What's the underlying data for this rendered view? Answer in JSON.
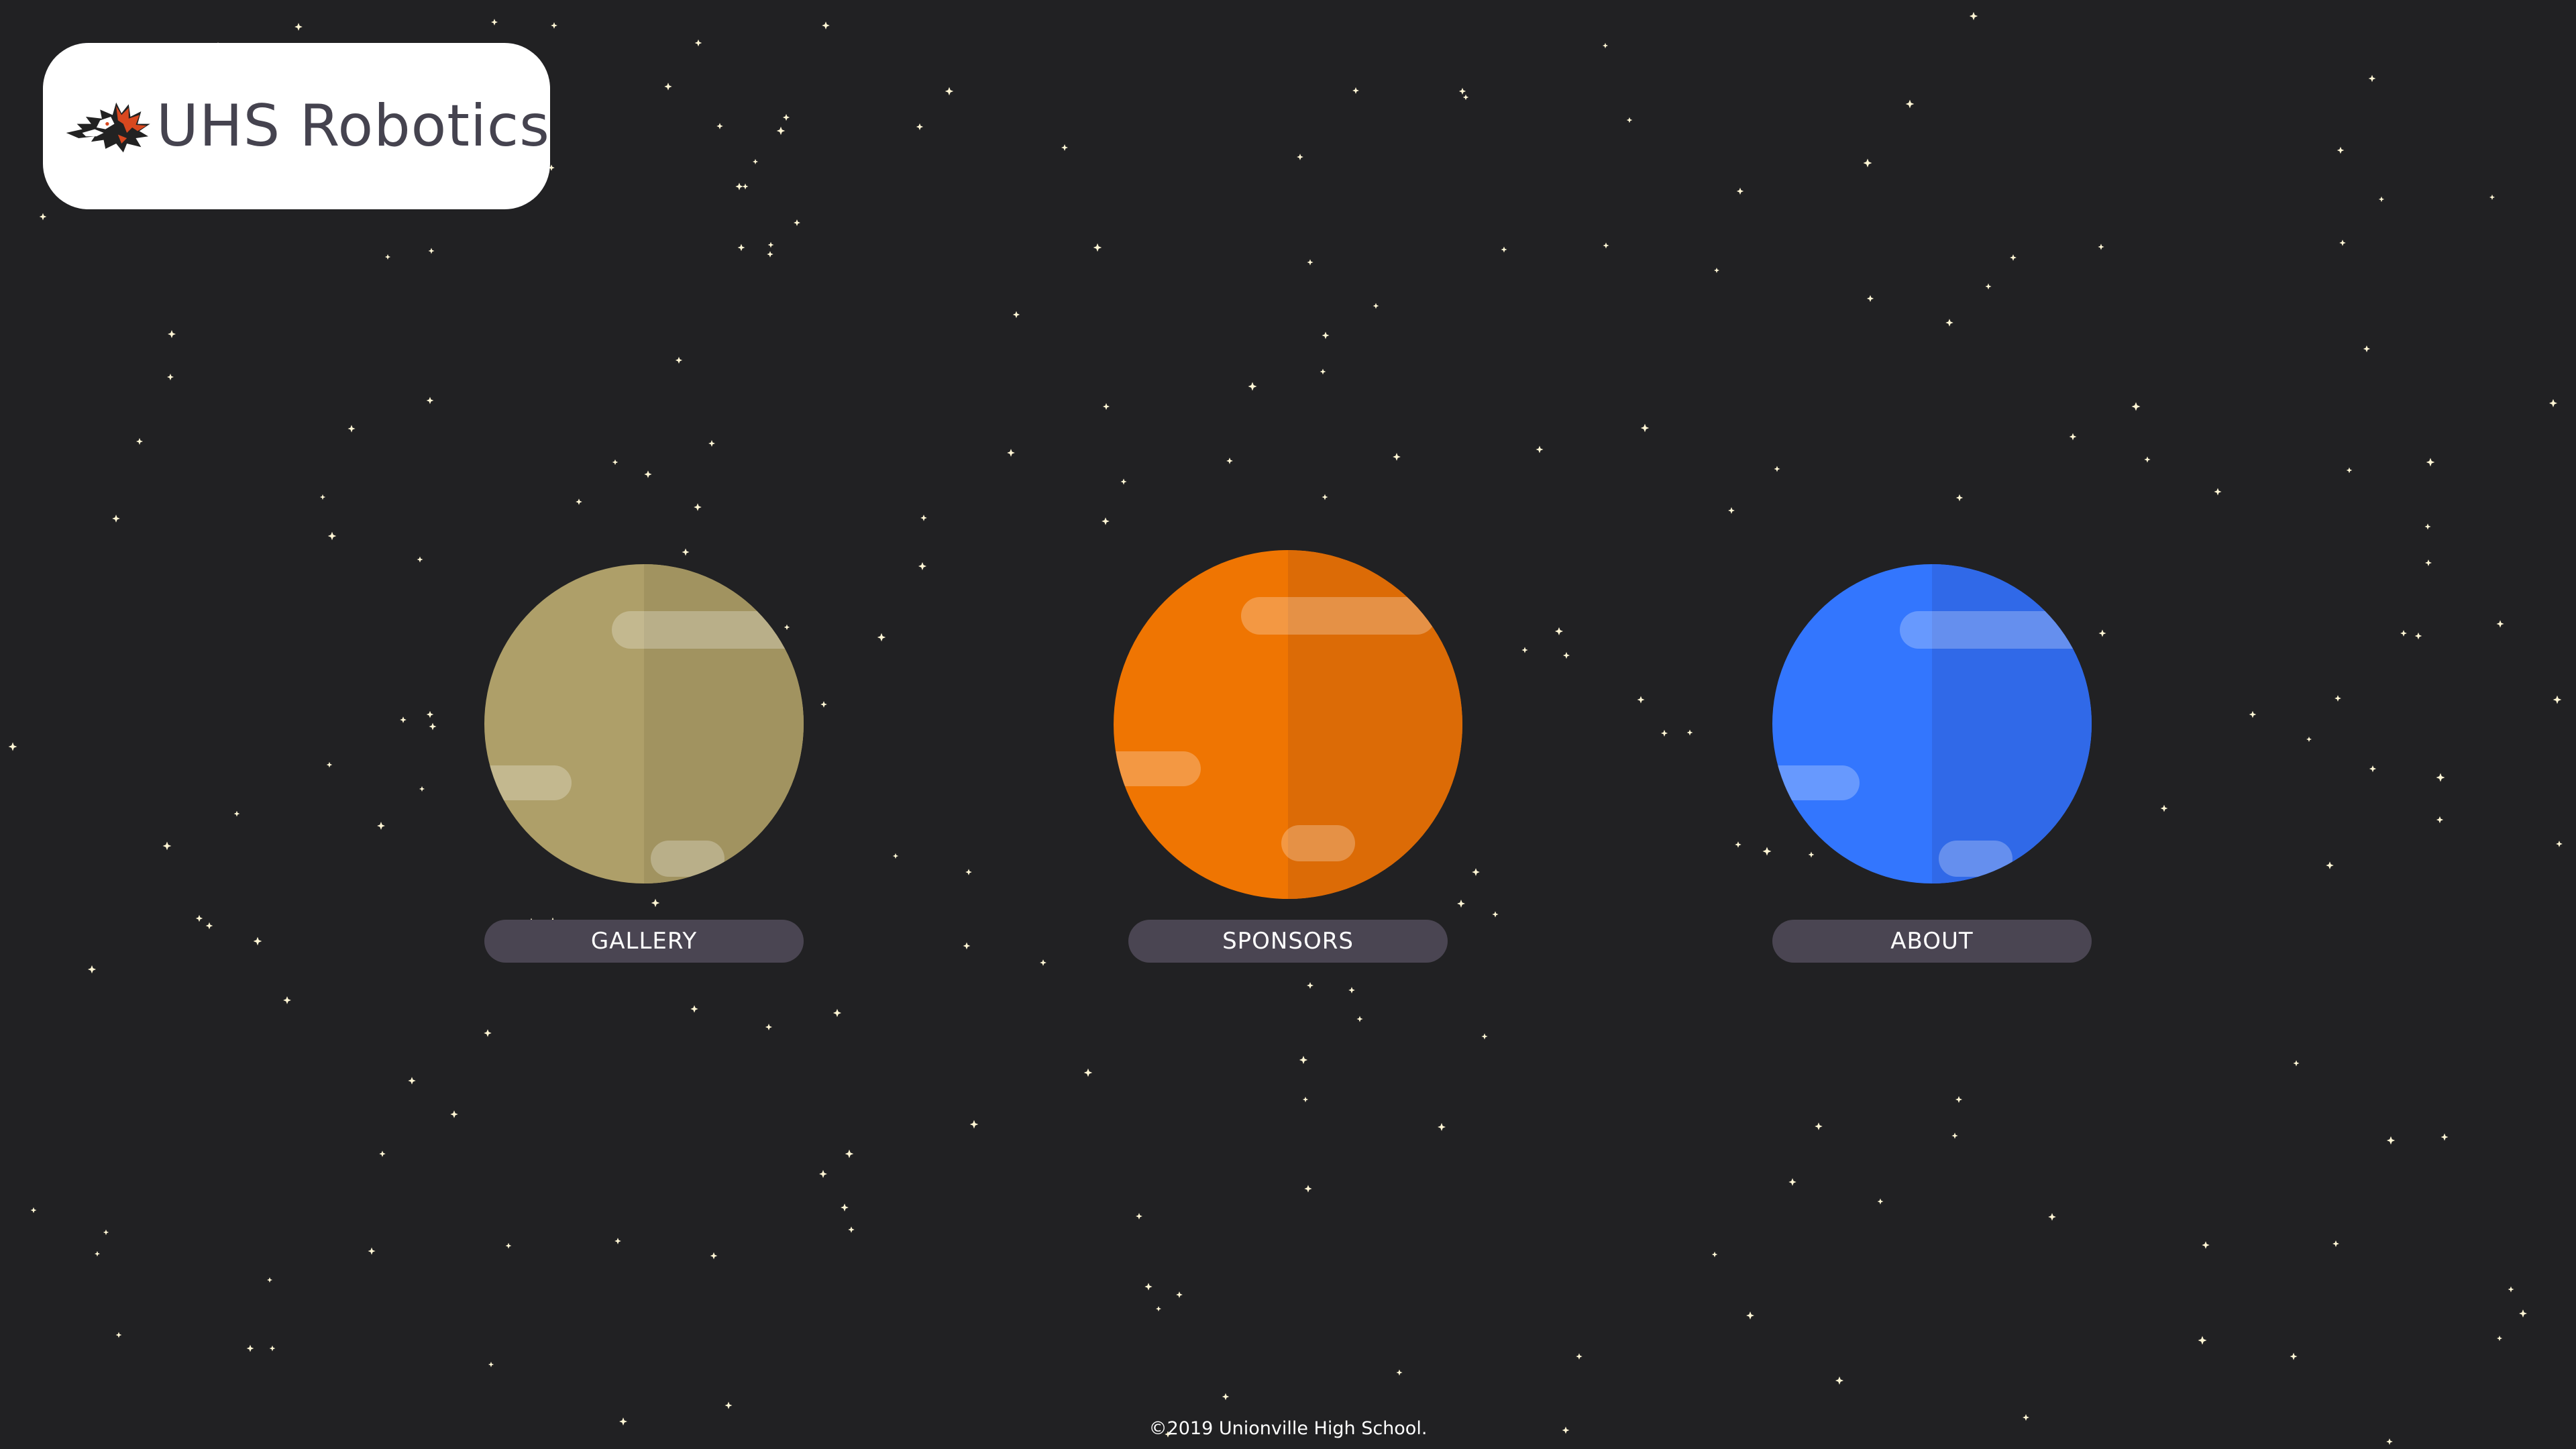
{
  "header": {
    "logo_text": "UHS Robotics",
    "logo_icon": "wolf-head-icon"
  },
  "nav": {
    "items": [
      {
        "label": "GALLERY",
        "planet_color": "#ae9f69",
        "planet_shade": "#a19360"
      },
      {
        "label": "SPONSORS",
        "planet_color": "#ef7502",
        "planet_shade": "#dc6b06"
      },
      {
        "label": "ABOUT",
        "planet_color": "#3376fe",
        "planet_shade": "#3069e8"
      }
    ]
  },
  "footer": {
    "copyright": "©2019 Unionville High School."
  },
  "colors": {
    "background": "#212123",
    "star": "#fff6d5",
    "label_bg": "#4a4552",
    "logo_box": "#ffffff",
    "logo_text": "#45434f"
  }
}
